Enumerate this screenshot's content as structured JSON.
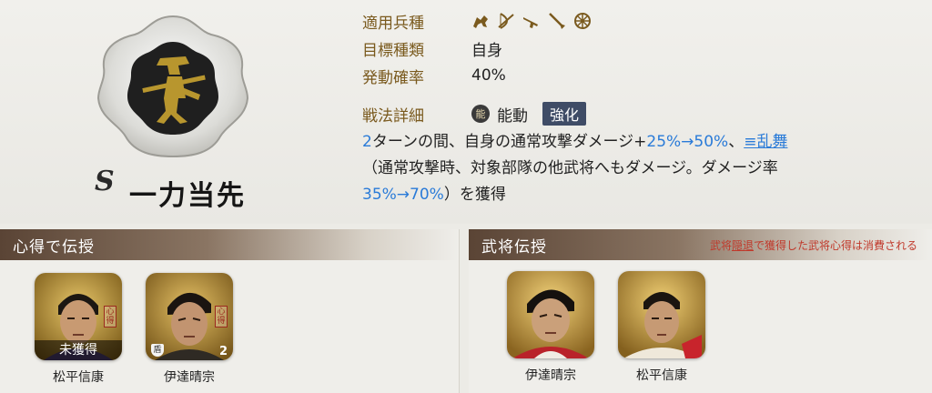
{
  "skill": {
    "rank": "S",
    "name": "一力当先",
    "emblem_icon": "spear-warrior-emblem-icon"
  },
  "info": {
    "troop_label": "適用兵種",
    "troop_icons": [
      "cavalry-icon",
      "archer-icon",
      "gun-icon",
      "spear-icon",
      "wheel-icon"
    ],
    "target_label": "目標種類",
    "target_value": "自身",
    "rate_label": "発動確率",
    "rate_value": "40%",
    "detail_label": "戦法詳細",
    "type_badge": "能",
    "type_value": "能動",
    "enhance_badge": "強化"
  },
  "description": {
    "turns": "2",
    "part1": "ターンの間、自身の通常攻撃ダメージ+",
    "dmg_change": "25%→50%",
    "part2": "、",
    "keyword": "≡乱舞",
    "part3": "（通常攻撃時、対象部隊の他武将へもダメージ。ダメージ率",
    "rate_change": "35%→70%",
    "part4": "）を獲得"
  },
  "left_panel": {
    "title": "心得で伝授",
    "cards": [
      {
        "name": "松平信康",
        "status": "未獲得",
        "stamp": "心得"
      },
      {
        "name": "伊達晴宗",
        "count": "2",
        "stamp": "心得",
        "badge": "盾"
      }
    ]
  },
  "right_panel": {
    "title": "武将伝授",
    "note_pre": "武将",
    "note_link": "隠退",
    "note_post": "で獲得した武将心得は消費される",
    "cards": [
      {
        "name": "伊達晴宗"
      },
      {
        "name": "松平信康"
      }
    ]
  },
  "colors": {
    "label": "#7a5a1e",
    "accent_blue": "#2a7bd8",
    "note_red": "#c0392b",
    "banner_dark": "#5a4435"
  }
}
